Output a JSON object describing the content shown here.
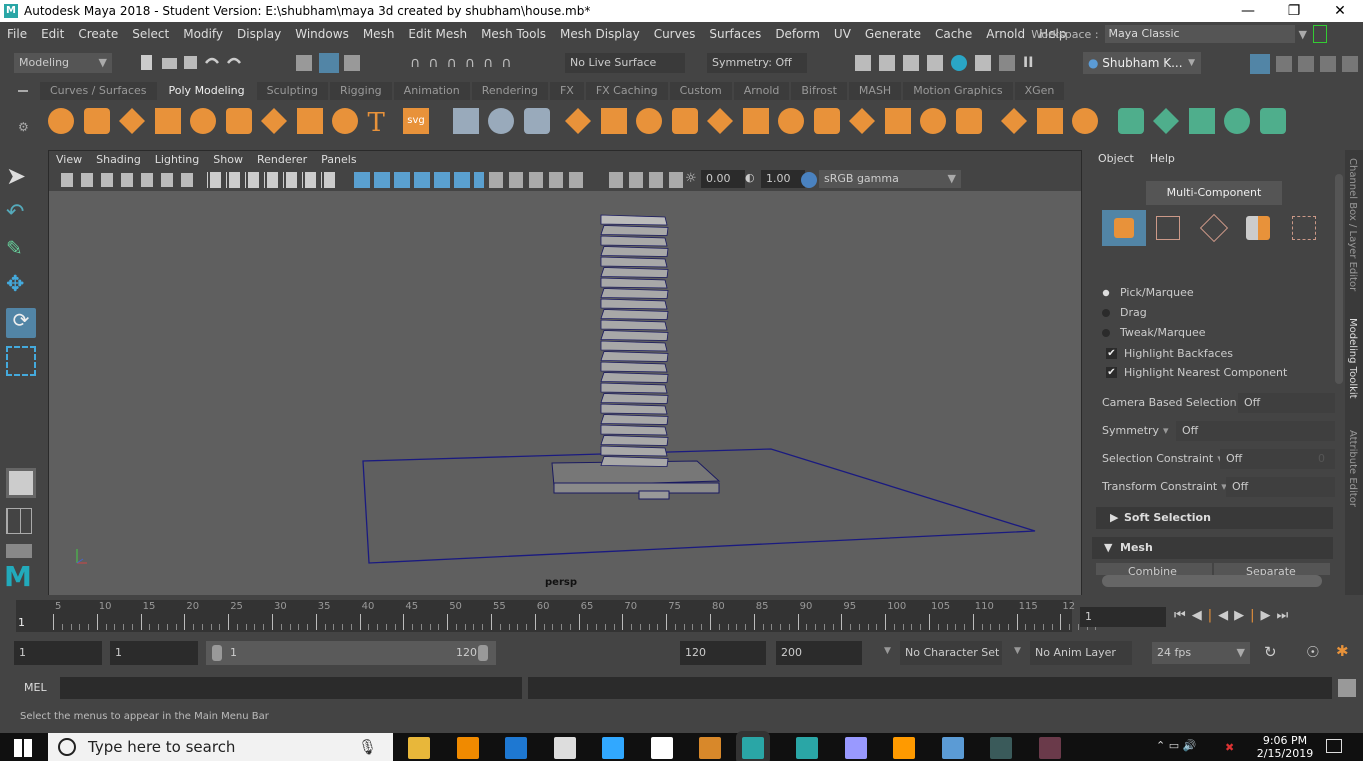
{
  "window": {
    "title": "Autodesk Maya 2018 - Student Version: E:\\shubham\\maya 3d created by shubham\\house.mb*",
    "logo": "M"
  },
  "menu": [
    "File",
    "Edit",
    "Create",
    "Select",
    "Modify",
    "Display",
    "Windows",
    "Mesh",
    "Edit Mesh",
    "Mesh Tools",
    "Mesh Display",
    "Curves",
    "Surfaces",
    "Deform",
    "UV",
    "Generate",
    "Cache",
    "Arnold",
    "Help"
  ],
  "workspace": {
    "label": "Workspace :",
    "value": "Maya Classic"
  },
  "status": {
    "mode": "Modeling",
    "live_surface": "No Live Surface",
    "symmetry": "Symmetry: Off",
    "user": "Shubham K..."
  },
  "shelf": {
    "tabs": [
      "Curves / Surfaces",
      "Poly Modeling",
      "Sculpting",
      "Rigging",
      "Animation",
      "Rendering",
      "FX",
      "FX Caching",
      "Custom",
      "Arnold",
      "Bifrost",
      "MASH",
      "Motion Graphics",
      "XGen"
    ],
    "active": "Poly Modeling",
    "icons": [
      "poly-sphere-icon",
      "poly-cube-icon",
      "poly-cylinder-icon",
      "poly-cone-icon",
      "poly-torus-icon",
      "poly-plane-icon",
      "poly-disc-icon",
      "platonic-solid-icon",
      "super-shape-icon",
      "text-icon",
      "svg-icon",
      "center-pivot-icon",
      "freeze-history-icon",
      "freeze-transform-icon",
      "combine-icon",
      "separate-icon",
      "extract-icon",
      "smooth-icon",
      "bool-icon",
      "mirror-icon",
      "extrude-icon",
      "bridge-icon",
      "bevel-icon",
      "insert-edge-loop-icon",
      "circularize-icon",
      "offset-loop-icon",
      "multi-cut-icon",
      "target-weld-icon",
      "quad-draw-icon",
      "uv-editor-icon",
      "planar-uv-icon",
      "cylindrical-uv-icon",
      "spherical-uv-icon",
      "auto-uv-icon"
    ],
    "accent": "#e8923a",
    "uv_color": "#4fae8c"
  },
  "viewport": {
    "menu": [
      "View",
      "Shading",
      "Lighting",
      "Show",
      "Renderer",
      "Panels"
    ],
    "exposure": "0.00",
    "gamma": "1.00",
    "color_space": "sRGB gamma",
    "camera": "persp"
  },
  "modeling_toolkit": {
    "menu": [
      "Object",
      "Help"
    ],
    "multi_component": "Multi-Component",
    "radios": [
      {
        "label": "Pick/Marquee",
        "selected": true
      },
      {
        "label": "Drag",
        "selected": false
      },
      {
        "label": "Tweak/Marquee",
        "selected": false
      }
    ],
    "checks": [
      {
        "label": "Highlight Backfaces",
        "checked": true
      },
      {
        "label": "Highlight Nearest Component",
        "checked": true
      }
    ],
    "options": [
      {
        "label": "Camera Based Selection",
        "value": "Off"
      },
      {
        "label": "Symmetry",
        "value": "Off"
      },
      {
        "label": "Selection Constraint",
        "value": "Off",
        "extra": "0"
      },
      {
        "label": "Transform Constraint",
        "value": "Off"
      }
    ],
    "sections": [
      {
        "label": "Soft Selection",
        "expanded": false
      },
      {
        "label": "Mesh",
        "expanded": true
      }
    ],
    "buttons": [
      "Combine",
      "Separate"
    ]
  },
  "side_tabs": [
    "Channel Box / Layer Editor",
    "Modeling Toolkit",
    "Attribute Editor"
  ],
  "timeline": {
    "ticks": [
      "5",
      "10",
      "15",
      "20",
      "25",
      "30",
      "35",
      "40",
      "45",
      "50",
      "55",
      "60",
      "65",
      "70",
      "75",
      "80",
      "85",
      "90",
      "95",
      "100",
      "105",
      "110",
      "115",
      "12"
    ],
    "current_marker": "1",
    "current_frame": "1"
  },
  "range": {
    "start": "1",
    "playback_start": "1",
    "slider_start": "1",
    "slider_end": "120",
    "playback_end": "120",
    "end": "200",
    "character_set": "No Character Set",
    "anim_layer": "No Anim Layer",
    "fps": "24 fps"
  },
  "command": {
    "label": "MEL"
  },
  "help_line": "Select the menus to appear in the Main Menu Bar",
  "taskbar": {
    "search_placeholder": "Type here to search",
    "time": "9:06 PM",
    "date": "2/15/2019",
    "apps": [
      {
        "name": "file-explorer-icon",
        "color": "#e8b73a"
      },
      {
        "name": "vlc-icon",
        "color": "#f08a00"
      },
      {
        "name": "edge-icon",
        "color": "#1e78d2"
      },
      {
        "name": "store-icon",
        "color": "#ddd"
      },
      {
        "name": "photoshop-icon",
        "color": "#31a8ff"
      },
      {
        "name": "mail-icon",
        "color": "#fff"
      },
      {
        "name": "app-e-icon",
        "color": "#d8882a"
      },
      {
        "name": "maya-icon",
        "color": "#2aa6a6"
      },
      {
        "name": "3dsmax-icon",
        "color": "#2aa6a6"
      },
      {
        "name": "after-effects-icon",
        "color": "#9999ff"
      },
      {
        "name": "illustrator-icon",
        "color": "#ff9a00"
      },
      {
        "name": "remote-desktop-icon",
        "color": "#5b9bd5"
      },
      {
        "name": "app-green-icon",
        "color": "#3a5a5a"
      },
      {
        "name": "app-red-icon",
        "color": "#6a3a4a"
      }
    ]
  }
}
